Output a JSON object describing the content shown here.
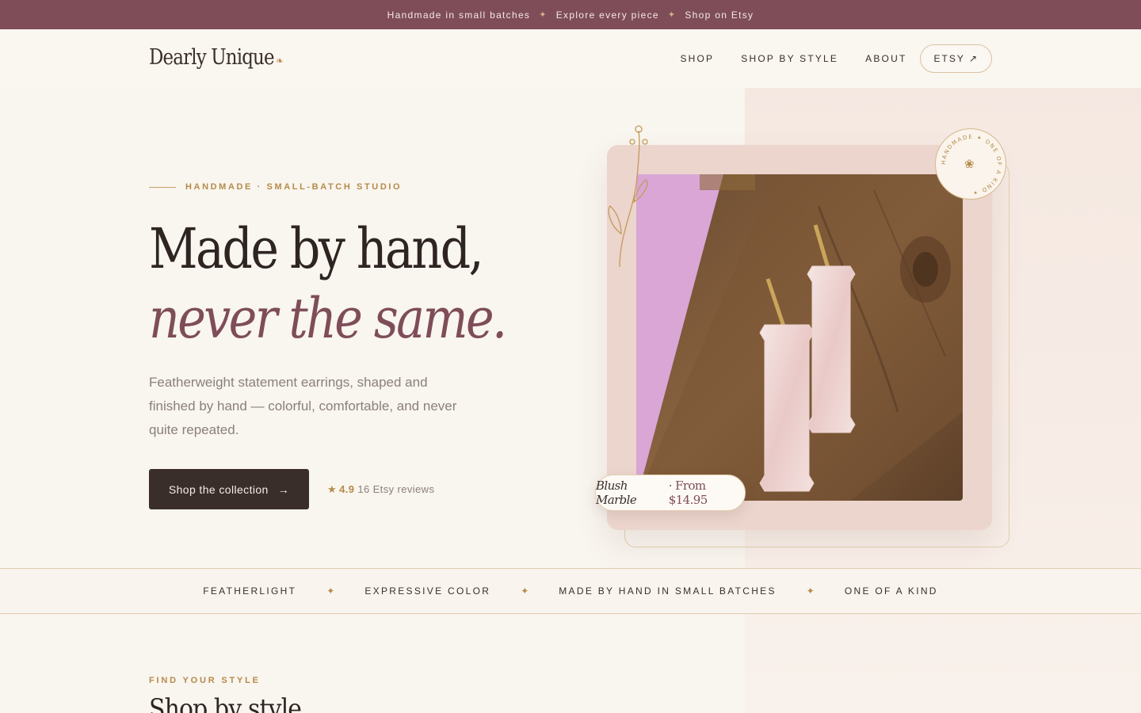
{
  "announcement": {
    "items": [
      "Handmade in small batches",
      "Explore every piece",
      "Shop on Etsy"
    ],
    "separator": "✦"
  },
  "header": {
    "logo": "Dearly Unique",
    "nav": [
      {
        "label": "SHOP"
      },
      {
        "label": "SHOP BY STYLE"
      },
      {
        "label": "ABOUT"
      }
    ],
    "etsy_button": "ETSY ↗"
  },
  "hero": {
    "eyebrow": "HANDMADE · SMALL-BATCH STUDIO",
    "headline_line1": "Made by hand,",
    "headline_line2": "never the same.",
    "lede": "Featherweight statement earrings, shaped and finished by hand — colorful, comfortable, and never quite repeated.",
    "cta_label": "Shop the collection",
    "cta_arrow": "→",
    "rating_score": "4.9",
    "rating_label": "16 Etsy reviews"
  },
  "feature_card": {
    "product_name": "Blush Marble",
    "product_price": " · From $14.95",
    "badge_text": "HANDMADE ✦ ONE OF A KIND ✦",
    "badge_icon": "flower-icon"
  },
  "values_strip": {
    "items": [
      "FEATHERLIGHT",
      "EXPRESSIVE COLOR",
      "MADE BY HAND IN SMALL BATCHES",
      "ONE OF A KIND"
    ],
    "separator": "✦"
  },
  "style_section": {
    "kicker": "FIND YOUR STYLE",
    "title": "Shop by style"
  },
  "colors": {
    "plum": "#7e4d58",
    "gold": "#b58b4a",
    "dark": "#3a2e2b",
    "cream": "#f9f5ef",
    "blush": "#ebd5cd"
  }
}
